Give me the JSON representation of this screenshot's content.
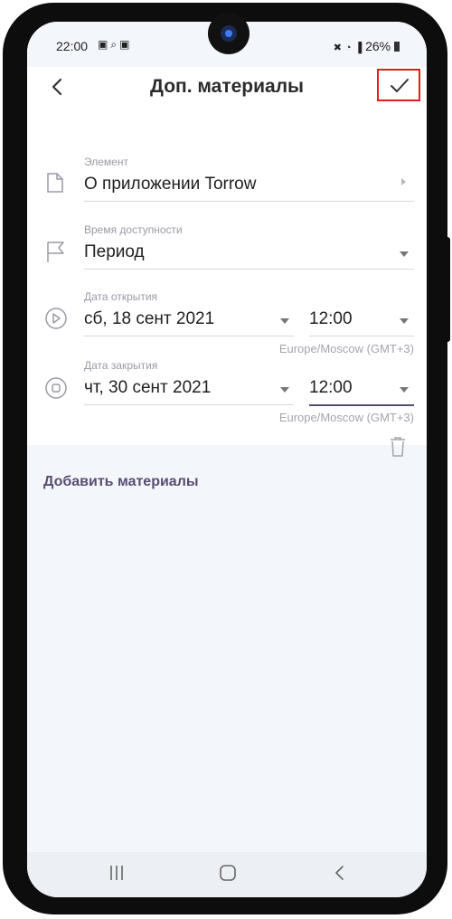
{
  "status_bar": {
    "time": "22:00",
    "left_icons": [
      "image-icon",
      "search-icon",
      "record-icon"
    ],
    "right_text": "26%",
    "right_icons": [
      "mute-icon",
      "wifi-icon",
      "signal-icon",
      "battery-icon"
    ]
  },
  "app_bar": {
    "title": "Доп. материалы",
    "back_icon": "chevron-left-icon",
    "confirm_icon": "check-icon"
  },
  "form": {
    "element": {
      "label": "Элемент",
      "value": "О приложении Torrow"
    },
    "availability": {
      "label": "Время доступности",
      "value": "Период"
    },
    "open_date": {
      "label": "Дата открытия",
      "date": "сб, 18 сент 2021",
      "time": "12:00",
      "timezone": "Europe/Moscow (GMT+3)"
    },
    "close_date": {
      "label": "Дата закрытия",
      "date": "чт, 30 сент 2021",
      "time": "12:00",
      "timezone": "Europe/Moscow (GMT+3)"
    }
  },
  "add_materials": {
    "label": "Добавить материалы"
  },
  "nav_bar": {
    "items": [
      "recent-apps-icon",
      "home-icon",
      "back-icon"
    ]
  },
  "colors": {
    "accent": "#5a4d72",
    "highlight_box": "#e11d1d",
    "background": "#f3f6fb"
  }
}
